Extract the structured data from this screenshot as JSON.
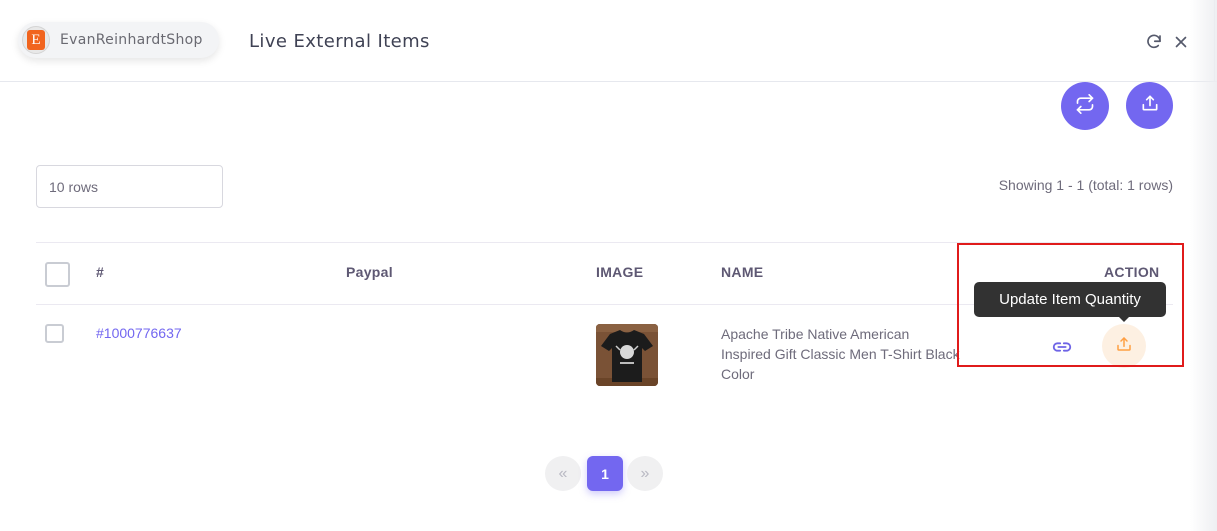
{
  "header": {
    "shop_name": "EvanReinhardtShop",
    "shop_avatar_letter": "E",
    "title": "Live External Items",
    "icons": [
      "refresh-icon",
      "close-icon"
    ]
  },
  "toolbar": {
    "sync_icon": "sync-arrows-icon",
    "export_icon": "upload-icon"
  },
  "controls": {
    "rows_value": "10 rows",
    "showing_text": "Showing 1 - 1 (total: 1 rows)"
  },
  "table": {
    "columns": [
      "#",
      "Paypal",
      "IMAGE",
      "NAME",
      "ACTION"
    ],
    "rows": [
      {
        "id": "#1000776637",
        "paypal": "",
        "image": "black-tshirt-thumbnail",
        "name": "Apache Tribe Native American Inspired Gift Classic Men T-Shirt Black Color",
        "actions": [
          "link-icon",
          "upload-icon"
        ]
      }
    ]
  },
  "tooltip": {
    "text": "Update Item Quantity"
  },
  "pagination": {
    "prev_label": "«",
    "current_page": "1",
    "next_label": "»"
  },
  "colors": {
    "primary": "#7367f0",
    "warning": "#ff9f43",
    "highlight": "#e01b1b",
    "tooltip_bg": "#323232"
  }
}
